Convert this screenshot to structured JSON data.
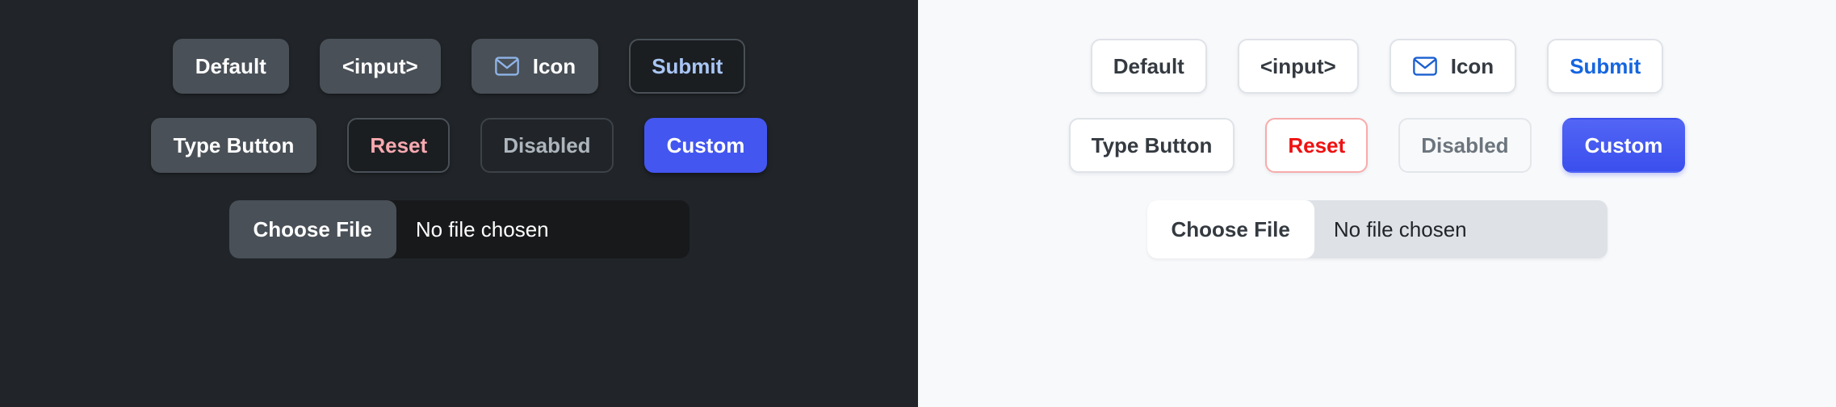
{
  "panels": [
    {
      "theme": "dark",
      "background": "#212529",
      "rows": [
        {
          "buttons": [
            {
              "label": "Default",
              "variant": "default",
              "icon": null
            },
            {
              "label": "<input>",
              "variant": "input",
              "icon": null
            },
            {
              "label": "Icon",
              "variant": "icon",
              "icon": "mail-icon"
            },
            {
              "label": "Submit",
              "variant": "submit",
              "icon": null
            }
          ]
        },
        {
          "buttons": [
            {
              "label": "Type Button",
              "variant": "type",
              "icon": null
            },
            {
              "label": "Reset",
              "variant": "reset",
              "icon": null
            },
            {
              "label": "Disabled",
              "variant": "disabled",
              "icon": null
            },
            {
              "label": "Custom",
              "variant": "custom",
              "icon": null
            }
          ]
        }
      ],
      "file_input": {
        "button_label": "Choose File",
        "status_label": "No file chosen"
      }
    },
    {
      "theme": "light",
      "background": "#f8f9fb",
      "rows": [
        {
          "buttons": [
            {
              "label": "Default",
              "variant": "default",
              "icon": null
            },
            {
              "label": "<input>",
              "variant": "input",
              "icon": null
            },
            {
              "label": "Icon",
              "variant": "icon",
              "icon": "mail-icon"
            },
            {
              "label": "Submit",
              "variant": "submit",
              "icon": null
            }
          ]
        },
        {
          "buttons": [
            {
              "label": "Type Button",
              "variant": "type",
              "icon": null
            },
            {
              "label": "Reset",
              "variant": "reset",
              "icon": null
            },
            {
              "label": "Disabled",
              "variant": "disabled",
              "icon": null
            },
            {
              "label": "Custom",
              "variant": "custom",
              "icon": null
            }
          ]
        }
      ],
      "file_input": {
        "button_label": "Choose File",
        "status_label": "No file chosen"
      }
    }
  ],
  "colors": {
    "dark_panel_bg": "#212529",
    "light_panel_bg": "#f8f9fb",
    "dark_button_bg": "#495057",
    "dark_button_text": "#ffffff",
    "dark_submit_text": "#a9c6f5",
    "dark_reset_text": "#f8a9b0",
    "dark_disabled_text": "#adb5bd",
    "dark_file_track": "#18191b",
    "light_button_bg": "#ffffff",
    "light_button_text": "#343a40",
    "light_button_border": "#dfe3e8",
    "light_submit_text": "#1565e0",
    "light_reset_text": "#ee1111",
    "light_reset_border": "#f8abab",
    "light_disabled_bg": "#f8f9fa",
    "light_disabled_text": "#6c757d",
    "light_file_track": "#dee1e6",
    "accent_custom": "#4356f0",
    "mail_icon_dark": "#8fb4e8",
    "mail_icon_light": "#1a5fd0"
  }
}
